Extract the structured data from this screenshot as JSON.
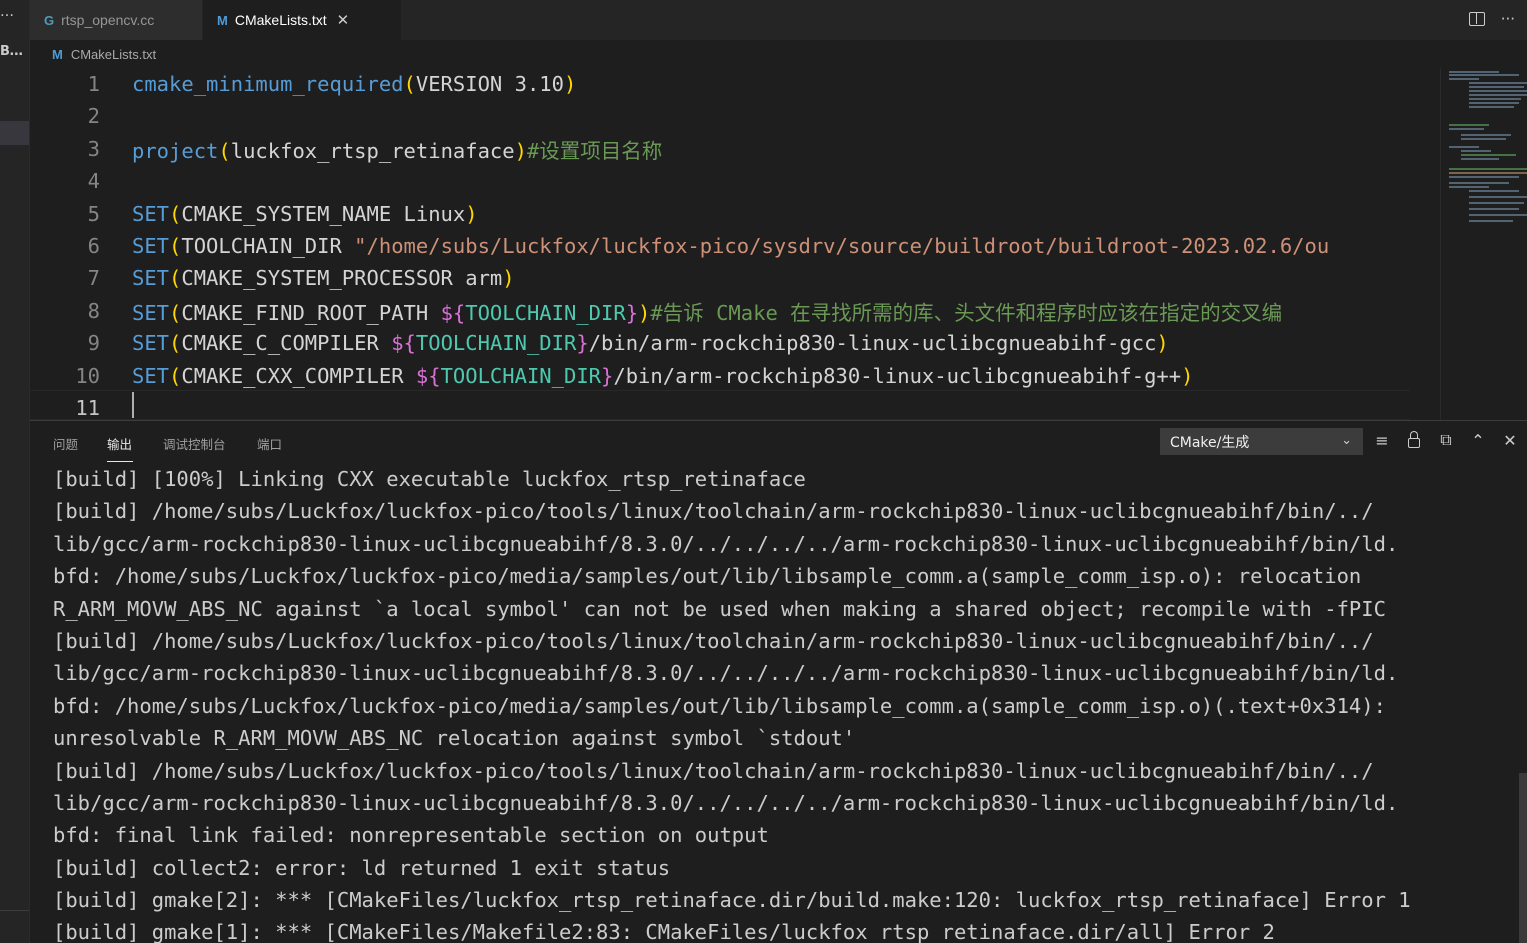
{
  "activity": {
    "more": "…",
    "explorer_label": "B..."
  },
  "tabs": [
    {
      "icon": "G",
      "label": "rtsp_opencv.cc"
    },
    {
      "icon": "M",
      "label": "CMakeLists.txt",
      "close": "✕"
    }
  ],
  "tab_actions": {
    "more": "···"
  },
  "breadcrumb": {
    "icon": "M",
    "file": "CMakeLists.txt"
  },
  "editor": {
    "line_numbers": [
      "1",
      "2",
      "3",
      "4",
      "5",
      "6",
      "7",
      "8",
      "9",
      "10",
      "11"
    ],
    "lines": [
      [
        [
          "fn",
          "cmake_minimum_required"
        ],
        [
          "paren",
          "("
        ],
        [
          "ident",
          "VERSION 3.10"
        ],
        [
          "paren",
          ")"
        ]
      ],
      [],
      [
        [
          "fn",
          "project"
        ],
        [
          "paren",
          "("
        ],
        [
          "ident",
          "luckfox_rtsp_retinaface"
        ],
        [
          "paren",
          ")"
        ],
        [
          "cmt",
          "#设置项目名称"
        ]
      ],
      [],
      [
        [
          "fn",
          "SET"
        ],
        [
          "paren",
          "("
        ],
        [
          "ident",
          "CMAKE_SYSTEM_NAME Linux"
        ],
        [
          "paren",
          ")"
        ]
      ],
      [
        [
          "fn",
          "SET"
        ],
        [
          "paren",
          "("
        ],
        [
          "ident",
          "TOOLCHAIN_DIR "
        ],
        [
          "str",
          "\"/home/subs/Luckfox/luckfox-pico/sysdrv/source/buildroot/buildroot-2023.02.6/ou"
        ]
      ],
      [
        [
          "fn",
          "SET"
        ],
        [
          "paren",
          "("
        ],
        [
          "ident",
          "CMAKE_SYSTEM_PROCESSOR arm"
        ],
        [
          "paren",
          ")"
        ]
      ],
      [
        [
          "fn",
          "SET"
        ],
        [
          "paren",
          "("
        ],
        [
          "ident",
          "CMAKE_FIND_ROOT_PATH "
        ],
        [
          "brace",
          "${"
        ],
        [
          "var",
          "TOOLCHAIN_DIR"
        ],
        [
          "brace",
          "}"
        ],
        [
          "paren",
          ")"
        ],
        [
          "cmt",
          "#告诉 CMake 在寻找所需的库、头文件和程序时应该在指定的交叉编"
        ]
      ],
      [
        [
          "fn",
          "SET"
        ],
        [
          "paren",
          "("
        ],
        [
          "ident",
          "CMAKE_C_COMPILER "
        ],
        [
          "brace",
          "${"
        ],
        [
          "var",
          "TOOLCHAIN_DIR"
        ],
        [
          "brace",
          "}"
        ],
        [
          "ident",
          "/bin/arm-rockchip830-linux-uclibcgnueabihf-gcc"
        ],
        [
          "paren",
          ")"
        ]
      ],
      [
        [
          "fn",
          "SET"
        ],
        [
          "paren",
          "("
        ],
        [
          "ident",
          "CMAKE_CXX_COMPILER "
        ],
        [
          "brace",
          "${"
        ],
        [
          "var",
          "TOOLCHAIN_DIR"
        ],
        [
          "brace",
          "}"
        ],
        [
          "ident",
          "/bin/arm-rockchip830-linux-uclibcgnueabihf-g++"
        ],
        [
          "paren",
          ")"
        ]
      ],
      []
    ]
  },
  "panel": {
    "tabs": [
      "问题",
      "输出",
      "调试控制台",
      "端口"
    ],
    "active_tab": "输出",
    "output_channel": "CMake/生成",
    "icons": [
      "list-filter-icon",
      "lock-icon",
      "clear-output-icon",
      "maximize-panel-icon",
      "close-panel-icon"
    ],
    "output_lines": [
      "[build] [100%] Linking CXX executable luckfox_rtsp_retinaface",
      "[build] /home/subs/Luckfox/luckfox-pico/tools/linux/toolchain/arm-rockchip830-linux-uclibcgnueabihf/bin/../",
      "lib/gcc/arm-rockchip830-linux-uclibcgnueabihf/8.3.0/../../../../arm-rockchip830-linux-uclibcgnueabihf/bin/ld.",
      "bfd: /home/subs/Luckfox/luckfox-pico/media/samples/out/lib/libsample_comm.a(sample_comm_isp.o): relocation",
      "R_ARM_MOVW_ABS_NC against `a local symbol' can not be used when making a shared object; recompile with -fPIC",
      "[build] /home/subs/Luckfox/luckfox-pico/tools/linux/toolchain/arm-rockchip830-linux-uclibcgnueabihf/bin/../",
      "lib/gcc/arm-rockchip830-linux-uclibcgnueabihf/8.3.0/../../../../arm-rockchip830-linux-uclibcgnueabihf/bin/ld.",
      "bfd: /home/subs/Luckfox/luckfox-pico/media/samples/out/lib/libsample_comm.a(sample_comm_isp.o)(.text+0x314):",
      "unresolvable R_ARM_MOVW_ABS_NC relocation against symbol `stdout'",
      "[build] /home/subs/Luckfox/luckfox-pico/tools/linux/toolchain/arm-rockchip830-linux-uclibcgnueabihf/bin/../",
      "lib/gcc/arm-rockchip830-linux-uclibcgnueabihf/8.3.0/../../../../arm-rockchip830-linux-uclibcgnueabihf/bin/ld.",
      "bfd: final link failed: nonrepresentable section on output",
      "[build] collect2: error: ld returned 1 exit status",
      "[build] gmake[2]: *** [CMakeFiles/luckfox_rtsp_retinaface.dir/build.make:120: luckfox_rtsp_retinaface] Error 1",
      "[build] gmake[1]: *** [CMakeFiles/Makefile2:83: CMakeFiles/luckfox_rtsp_retinaface.dir/all] Error 2"
    ]
  },
  "colors": {
    "background": "#1e1e1e",
    "keyword": "#569cd6",
    "string": "#ce9178",
    "comment": "#6a9955",
    "paren": "#ffd700"
  }
}
